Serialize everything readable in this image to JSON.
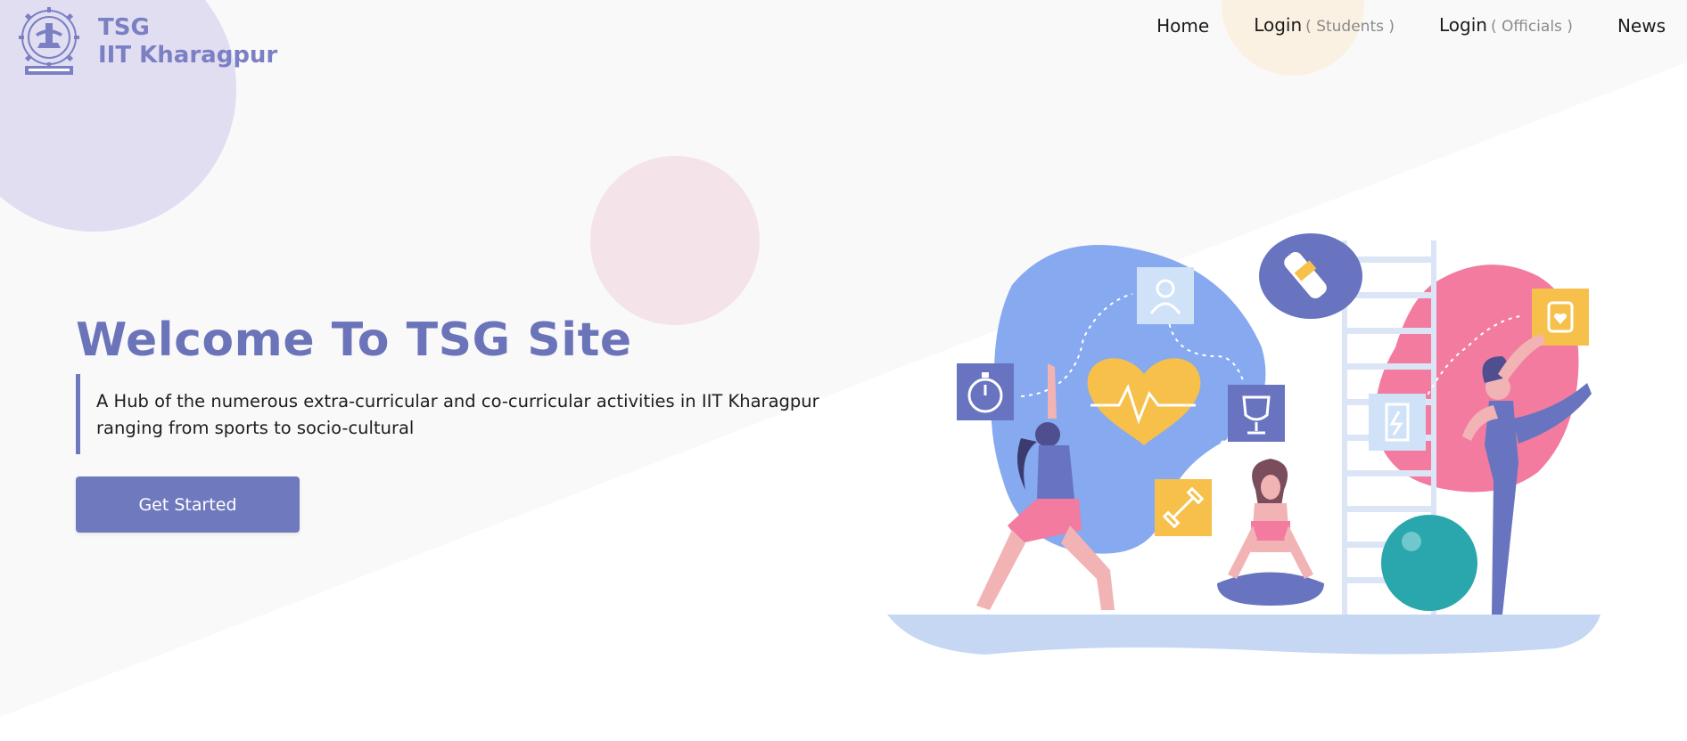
{
  "brand": {
    "line1": "TSG",
    "line2": "IIT Kharagpur"
  },
  "nav": {
    "home": "Home",
    "login_students": "Login",
    "login_students_sub": "( Students )",
    "login_officials": "Login",
    "login_officials_sub": "( Officials )",
    "news": "News"
  },
  "hero": {
    "title": "Welcome To TSG Site",
    "description": "A Hub of the numerous extra-curricular and co-curricular activities in IIT Kharagpur ranging from sports to socio-cultural",
    "cta_label": "Get Started"
  },
  "colors": {
    "accent": "#6f79bd",
    "brand_text": "#7b7fc4",
    "background_band": "#f8f8fa"
  }
}
